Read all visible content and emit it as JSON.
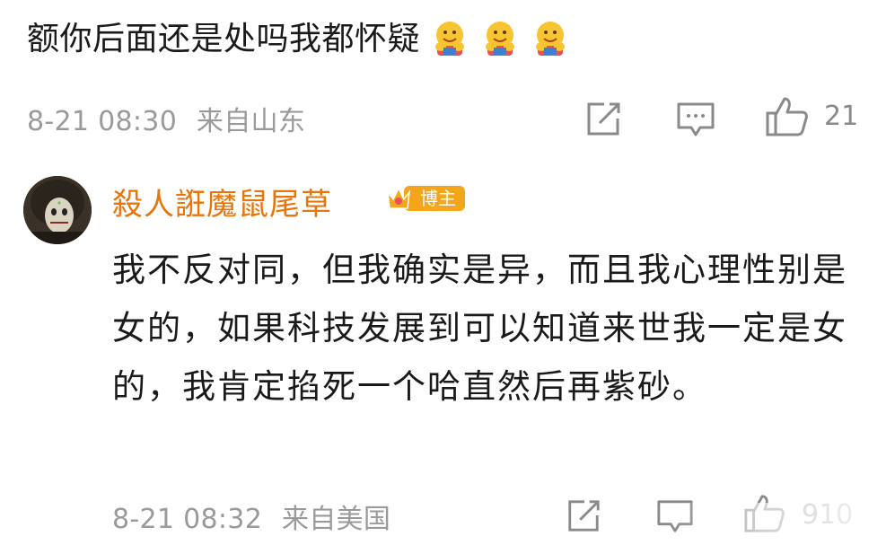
{
  "comment1": {
    "text": "额你后面还是处吗我都怀疑",
    "emojis": [
      "hugging-face-icon",
      "hugging-face-icon",
      "hugging-face-icon"
    ],
    "date": "8-21 08:30",
    "location": "来自山东",
    "like_count": "21"
  },
  "reply": {
    "username": "殺人誑魔鼠尾草",
    "badge": "博主",
    "text": "我不反对同，但我确实是异，而且我心理性别是女的，如果科技发展到可以知道来世我一定是女的，我肯定掐死一个哈直然后再紫砂。",
    "date": "8-21 08:32",
    "location": "来自美国",
    "like_count": "910"
  },
  "colors": {
    "username": "#e8740a",
    "meta": "#9a9a9a",
    "text": "#1a1a1a",
    "badge_bg": "#f3a51c"
  }
}
